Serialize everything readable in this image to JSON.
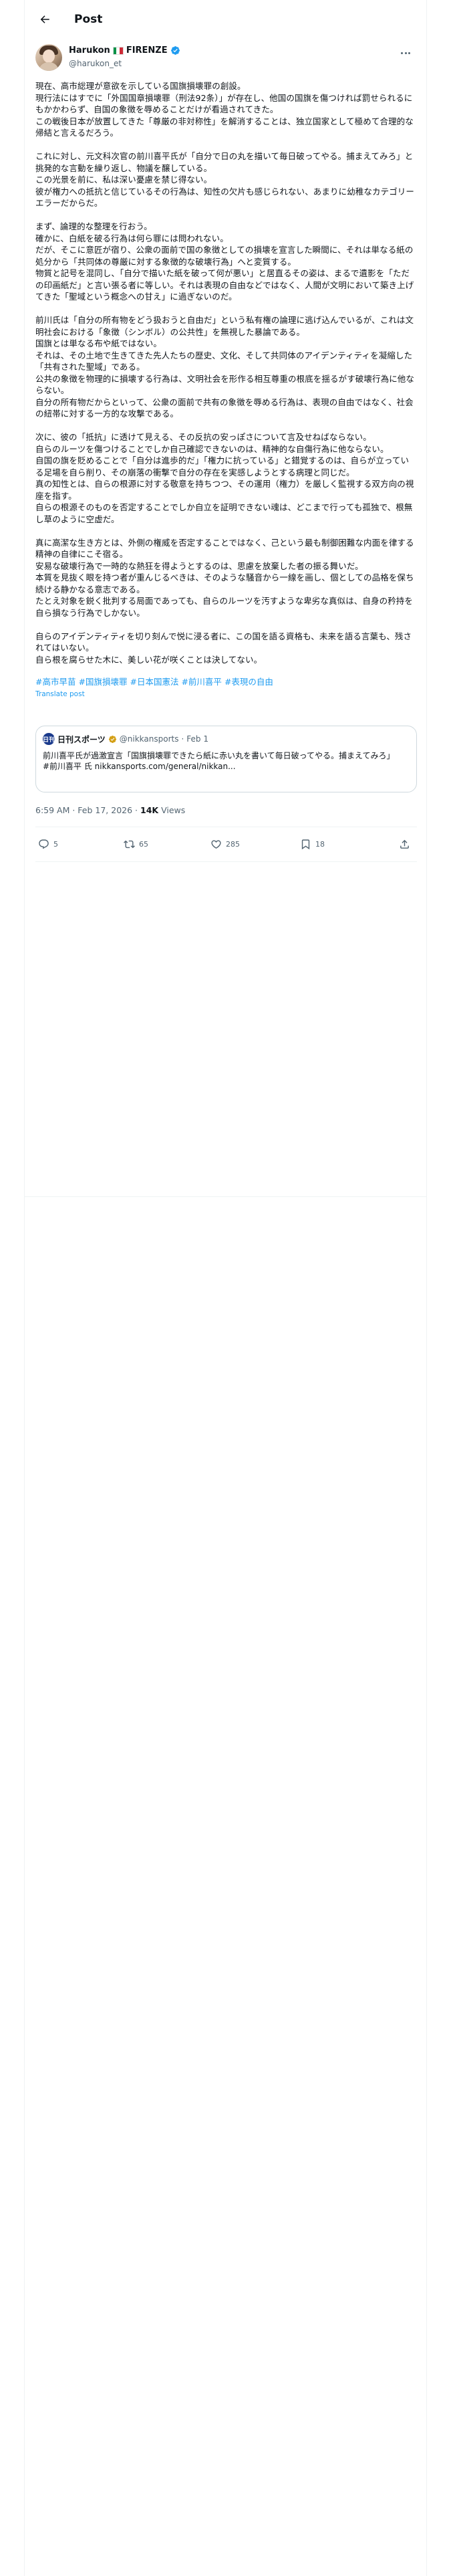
{
  "header": {
    "title": "Post"
  },
  "author": {
    "name": "Harukon",
    "flag_name": "FIRENZE",
    "handle": "@harukon_et",
    "flag_colors": [
      "#009246",
      "#ffffff",
      "#ce2b37"
    ],
    "verified_color": "#1d9bf0"
  },
  "post": {
    "paragraphs": [
      "現在、高市総理が意欲を示している国旗損壊罪の創設。\n現行法にはすでに「外国国章損壊罪（刑法92条）」が存在し、他国の国旗を傷つければ罰せられるにもかかわらず、自国の象徴を辱めることだけが看過されてきた。\nこの戦後日本が放置してきた「尊厳の非対称性」を解消することは、独立国家として極めて合理的な帰結と言えるだろう。",
      "これに対し、元文科次官の前川喜平氏が「自分で日の丸を描いて毎日破ってやる。捕まえてみろ」と挑発的な言動を繰り返し、物議を醸している。\nこの光景を前に、私は深い憂慮を禁じ得ない。\n彼が権力への抵抗と信じているその行為は、知性の欠片も感じられない、あまりに幼稚なカテゴリーエラーだからだ。",
      "まず、論理的な整理を行おう。\n確かに、白紙を破る行為は何ら罪には問われない。\nだが、そこに意匠が宿り、公衆の面前で国の象徴としての損壊を宣言した瞬間に、それは単なる紙の処分から「共同体の尊厳に対する象徴的な破壊行為」へと変質する。\n物質と記号を混同し、「自分で描いた紙を破って何が悪い」と居直るその姿は、まるで遺影を「ただの印画紙だ」と言い張る者に等しい。それは表現の自由などではなく、人間が文明において築き上げてきた「聖域という概念への甘え」に過ぎないのだ。",
      "前川氏は「自分の所有物をどう扱おうと自由だ」という私有権の論理に逃げ込んでいるが、これは文明社会における「象徴（シンボル）の公共性」を無視した暴論である。\n国旗とは単なる布や紙ではない。\nそれは、その土地で生きてきた先人たちの歴史、文化、そして共同体のアイデンティティを凝縮した「共有された聖域」である。\n公共の象徴を物理的に損壊する行為は、文明社会を形作る相互尊重の根底を揺るがす破壊行為に他ならない。\n自分の所有物だからといって、公衆の面前で共有の象徴を辱める行為は、表現の自由ではなく、社会の紐帯に対する一方的な攻撃である。",
      "次に、彼の「抵抗」に透けて見える、その反抗の安っぽさについて言及せねばならない。\n自らのルーツを傷つけることでしか自己確認できないのは、精神的な自傷行為に他ならない。\n自国の旗を貶めることで「自分は進歩的だ」「権力に抗っている」と錯覚するのは、自らが立っている足場を自ら削り、その崩落の衝撃で自分の存在を実感しようとする病理と同じだ。\n真の知性とは、自らの根源に対する敬意を持ちつつ、その運用（権力）を厳しく監視する双方向の視座を指す。\n自らの根源そのものを否定することでしか自立を証明できない魂は、どこまで行っても孤独で、根無し草のように空虚だ。",
      "真に高潔な生き方とは、外側の権威を否定することではなく、己という最も制御困難な内面を律する精神の自律にこそ宿る。\n安易な破壊行為で一時的な熱狂を得ようとするのは、思慮を放棄した者の振る舞いだ。\n本質を見抜く眼を持つ者が重んじるべきは、そのような騒音から一線を画し、個としての品格を保ち続ける静かなる意志である。\nたとえ対象を鋭く批判する局面であっても、自らのルーツを汚すような卑劣な真似は、自身の矜持を自ら損なう行為でしかない。",
      "自らのアイデンティティを切り刻んで悦に浸る者に、この国を語る資格も、未来を語る言葉も、残されてはいない。\n自ら根を腐らせた木に、美しい花が咲くことは決してない。"
    ],
    "hashtags": [
      "#高市早苗",
      "#国旗損壊罪",
      "#日本国憲法",
      "#前川喜平",
      "#表現の自由"
    ],
    "translate_label": "Translate post"
  },
  "quote": {
    "logo_text": "日刊",
    "name": "日刊スポーツ",
    "handle": "@nikkansports",
    "date": "Feb 1",
    "text": "前川喜平氏が過激宣言「国旗損壊罪できたら紙に赤い丸を書いて毎日破ってやる。捕まえてみろ」\n#前川喜平 氏 nikkansports.com/general/nikkan..."
  },
  "meta": {
    "time": "6:59 AM · Feb 17, 2026 · ",
    "views_count": "14K",
    "views_label": " Views"
  },
  "actions": {
    "replies": "5",
    "reposts": "65",
    "likes": "285",
    "bookmarks": "18"
  }
}
